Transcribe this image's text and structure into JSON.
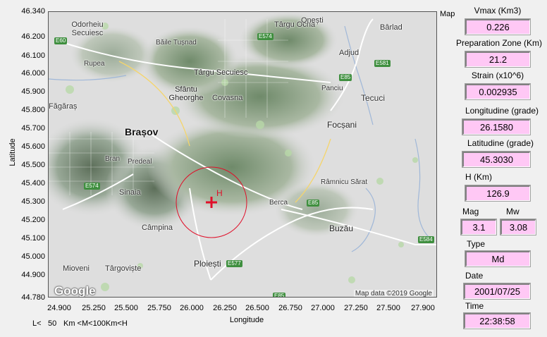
{
  "axes": {
    "ylabel": "Latitude",
    "xlabel": "Longitude",
    "yticks": [
      "46.340",
      "46.200",
      "46.100",
      "46.000",
      "45.900",
      "45.800",
      "45.700",
      "45.600",
      "45.500",
      "45.400",
      "45.300",
      "45.200",
      "45.100",
      "45.000",
      "44.900",
      "44.780"
    ],
    "xticks": [
      "24.900",
      "25.250",
      "25.500",
      "25.750",
      "26.000",
      "26.250",
      "26.500",
      "26.750",
      "27.000",
      "27.250",
      "27.500",
      "27.900"
    ]
  },
  "map": {
    "tab_label": "Map",
    "attribution": "Map data ©2019 Google",
    "logo": "Google",
    "hypocenter_label": "H",
    "cities": [
      "Odorheiu Secuiesc",
      "Băile Tușnad",
      "Târgu Ocna",
      "Onești",
      "Bârlad",
      "Rupea",
      "Târgu Secuiesc",
      "Adjud",
      "Sfântu Gheorghe",
      "Covasna",
      "Panciu",
      "Tecuci",
      "Făgăraș",
      "Brașov",
      "Focșani",
      "Bran",
      "Predeal",
      "Sinaia",
      "Râmnicu Sărat",
      "Berca",
      "Câmpina",
      "Buzău",
      "Mioveni",
      "Târgoviște",
      "Ploiești"
    ],
    "roads": [
      "E60",
      "E574",
      "E85",
      "E581",
      "E574",
      "E85",
      "E577",
      "E584",
      "E85"
    ],
    "colors": {
      "circle": "#e0102a",
      "marker": "#e0102a"
    }
  },
  "panel": {
    "vmax_label": "Vmax (Km3)",
    "vmax": "0.226",
    "prep_label": "Preparation Zone (Km)",
    "prep": "21.2",
    "strain_label": "Strain (x10^6)",
    "strain": "0.002935",
    "lon_label": "Longitudine (grade)",
    "lon": "26.1580",
    "lat_label": "Latitudine (grade)",
    "lat": "45.3030",
    "h_label": "H (Km)",
    "h": "126.9",
    "mag_label": "Mag",
    "mag": "3.1",
    "mw_label": "Mw",
    "mw": "3.08",
    "type_label": "Type",
    "type": "Md",
    "date_label": "Date",
    "date": "2001/07/25",
    "time_label": "Time",
    "time": "22:38:58"
  },
  "footer": {
    "l_label": "L<",
    "l_value": "50",
    "range_text": "Km <M<100Km<H"
  }
}
